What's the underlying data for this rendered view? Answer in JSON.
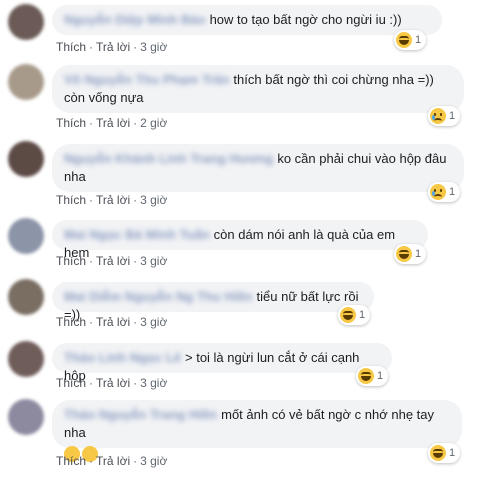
{
  "action_labels": {
    "like": "Thích",
    "reply": "Trả lời",
    "separator": "·"
  },
  "comments": [
    {
      "author": "Nguyễn Diệp Minh Bảo",
      "text": "how to tạo bất ngờ cho ngừi iu :))",
      "text2": "",
      "time": "3 giờ",
      "reaction": "haha-icon",
      "count": "1",
      "avatar_color": "#6b5a55"
    },
    {
      "author": "Võ Nguyễn Thu Phạm Trân",
      "text": "thích bất ngờ thì coi chừng nha =))",
      "text2": "còn vống nựa",
      "time": "2 giờ",
      "reaction": "sad-icon",
      "count": "1",
      "avatar_color": "#a89a8a"
    },
    {
      "author": "Nguyễn Khánh Linh Trang Hương",
      "text": "ko cần phải chui vào hộp đâu",
      "text2": "nha",
      "time": "3 giờ",
      "reaction": "sad-icon",
      "count": "1",
      "avatar_color": "#5c4a45"
    },
    {
      "author": "Mai Ngọc Bá Minh Tuấn",
      "text": "còn dám nói anh là quà của em hem",
      "text2": "",
      "time": "3 giờ",
      "reaction": "haha-icon",
      "count": "1",
      "avatar_color": "#8c94a8"
    },
    {
      "author": "Mai Diễm Nguyễn Ng Thu Hiền",
      "text": "tiểu nữ bất lực rồi =))",
      "text2": "",
      "time": "3 giờ",
      "reaction": "haha-icon",
      "count": "1",
      "avatar_color": "#7a6e63"
    },
    {
      "author": "Thảo Linh Ngọc Lê",
      "text": "> toi là ngừi lun cắt ở cái cạnh hộp",
      "text2": "",
      "time": "3 giờ",
      "reaction": "haha-icon",
      "count": "1",
      "avatar_color": "#6f5d5a"
    },
    {
      "author": "Thảo Nguyễn Trang Hiền",
      "text": "mốt ảnh có vẻ bất ngờ c nhớ nhẹ tay nha",
      "text2": "",
      "time": "3 giờ",
      "reaction": "haha-icon",
      "count": "1",
      "avatar_color": "#8d8aa0"
    }
  ]
}
